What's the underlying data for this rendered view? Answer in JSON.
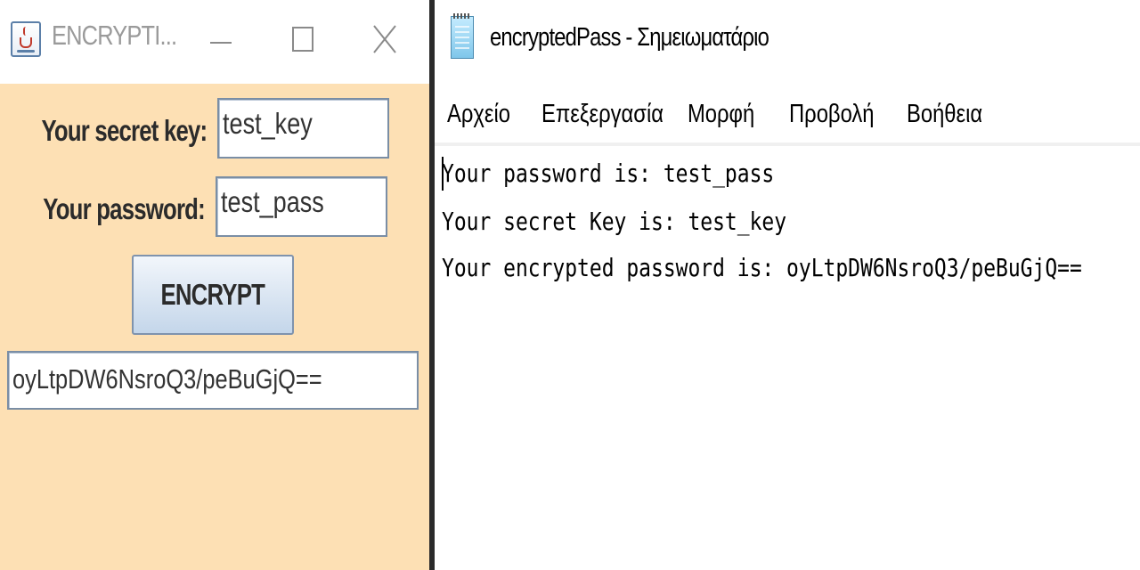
{
  "java_window": {
    "title": "ENCRYPTI...",
    "icon": "java-cup-icon",
    "labels": {
      "secret_key": "Your secret key:",
      "password": "Your password:"
    },
    "inputs": {
      "secret_key_value": "test_key",
      "password_value": "test_pass",
      "output_value": "oyLtpDW6NsroQ3/peBuGjQ=="
    },
    "button_label": "ENCRYPT",
    "colors": {
      "background": "#fde0b4",
      "button_gradient_bottom": "#c4d6ea"
    }
  },
  "notepad": {
    "title": "encryptedPass - Σημειωματάριο",
    "icon": "notepad-icon",
    "menu": [
      "Αρχείο",
      "Επεξεργασία",
      "Μορφή",
      "Προβολή",
      "Βοήθεια"
    ],
    "content_lines": [
      "Your password is: test_pass",
      "Your secret Key is: test_key",
      "Your encrypted password is: oyLtpDW6NsroQ3/peBuGjQ=="
    ]
  }
}
